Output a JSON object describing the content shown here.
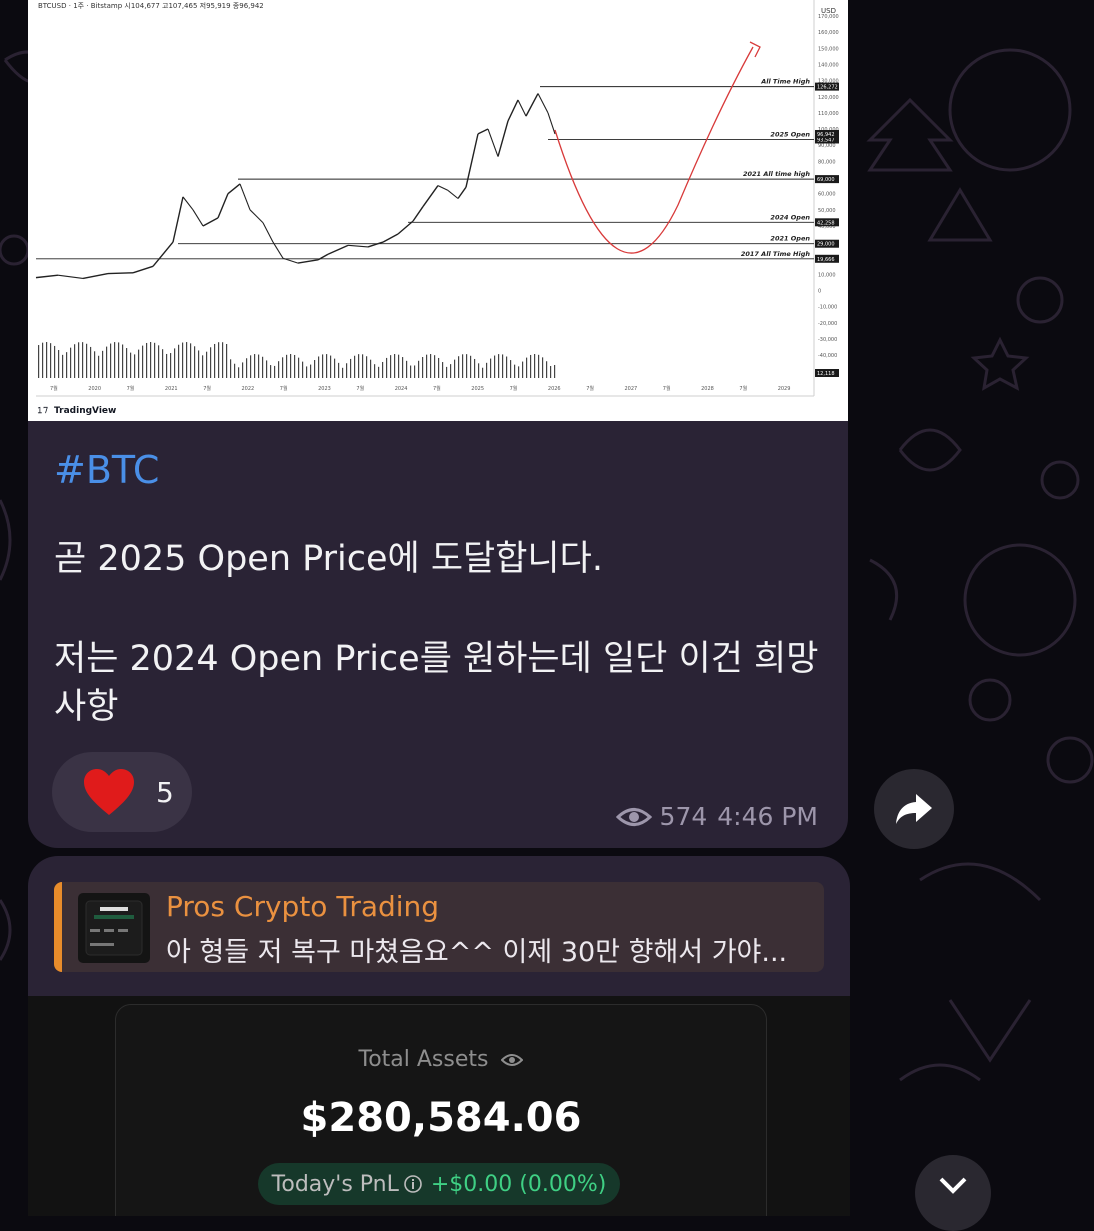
{
  "chart": {
    "header": "BTCUSD · 1주 · Bitstamp  시104,677  고107,465  저95,919  종96,942",
    "currency": "USD",
    "watermark": "TradingView",
    "y_ticks": [
      "170,000",
      "160,000",
      "150,000",
      "140,000",
      "130,000",
      "120,000",
      "110,000",
      "100,000",
      "90,000",
      "80,000",
      "70,000",
      "60,000",
      "50,000",
      "40,000",
      "30,000",
      "20,000",
      "10,000",
      "0",
      "-10,000",
      "-20,000",
      "-30,000",
      "-40,000"
    ],
    "x_ticks": [
      "7월",
      "2020",
      "7월",
      "2021",
      "7월",
      "2022",
      "7월",
      "2023",
      "7월",
      "2024",
      "7월",
      "2025",
      "7월",
      "2026",
      "7월",
      "2027",
      "7월",
      "2028",
      "7월",
      "2029"
    ],
    "levels": [
      {
        "label": "All Time High",
        "price_tag": "126,272"
      },
      {
        "label": "2025 Open",
        "price_tag": "93,547"
      },
      {
        "label": "2021 All time high",
        "price_tag": "69,000"
      },
      {
        "label": "2024 Open",
        "price_tag": "42,258"
      },
      {
        "label": "2021 Open",
        "price_tag": "29,000"
      },
      {
        "label": "2017 All Time High",
        "price_tag": "19,666"
      }
    ],
    "current_tag": "96,942",
    "volume_tag": "12,118"
  },
  "message1": {
    "hashtag": "#BTC",
    "line1": "곧 2025 Open Price에 도달합니다.",
    "line2": "저는 2024 Open Price를 원하는데 일단 이건 희망사항",
    "reaction_count": "5",
    "views": "574",
    "time": "4:46 PM"
  },
  "message2": {
    "reply_sender": "Pros Crypto Trading",
    "reply_snippet": "아 형들 저 복구 마쳤음요^^ 이제 30만 향해서 가야...",
    "assets_label": "Total Assets",
    "assets_value": "$280,584.06",
    "pnl_label": "Today's PnL",
    "pnl_value": "+$0.00 (0.00%)"
  },
  "colors": {
    "bubble": "#2a2335",
    "hashtag": "#4a8fe7",
    "reply_accent": "#e88c2b",
    "pnl_green": "#3fd084",
    "heart": "#e01b1b"
  }
}
